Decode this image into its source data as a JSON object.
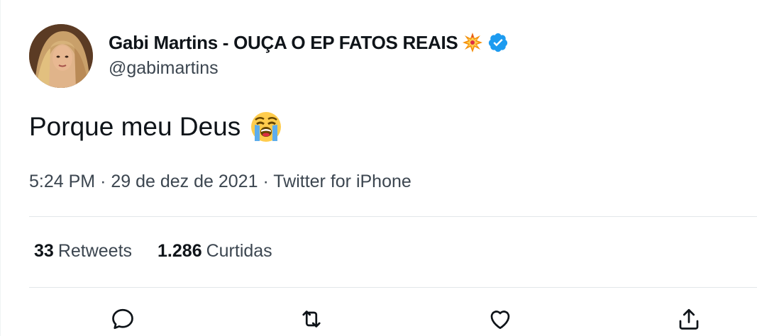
{
  "author": {
    "display_name": "Gabi Martins - OUÇA O EP FATOS REAIS",
    "handle": "@gabimartins",
    "verified": true,
    "name_emoji": "collision-icon",
    "avatar": "avatar-photo"
  },
  "tweet": {
    "text": "Porque meu Deus",
    "emoji": "loudly-crying-face-icon"
  },
  "meta": {
    "time": "5:24 PM",
    "separator": "·",
    "date": "29 de dez de 2021",
    "source": "Twitter for iPhone"
  },
  "stats": {
    "retweets_count": "33",
    "retweets_label": "Retweets",
    "likes_count": "1.286",
    "likes_label": "Curtidas"
  },
  "actions": {
    "reply_icon": "reply-icon",
    "retweet_icon": "retweet-icon",
    "like_icon": "heart-icon",
    "share_icon": "share-icon"
  },
  "colors": {
    "verified": "#1d9bf0",
    "text": "#0f1419",
    "secondary": "#536471",
    "divider": "#eff3f4"
  }
}
